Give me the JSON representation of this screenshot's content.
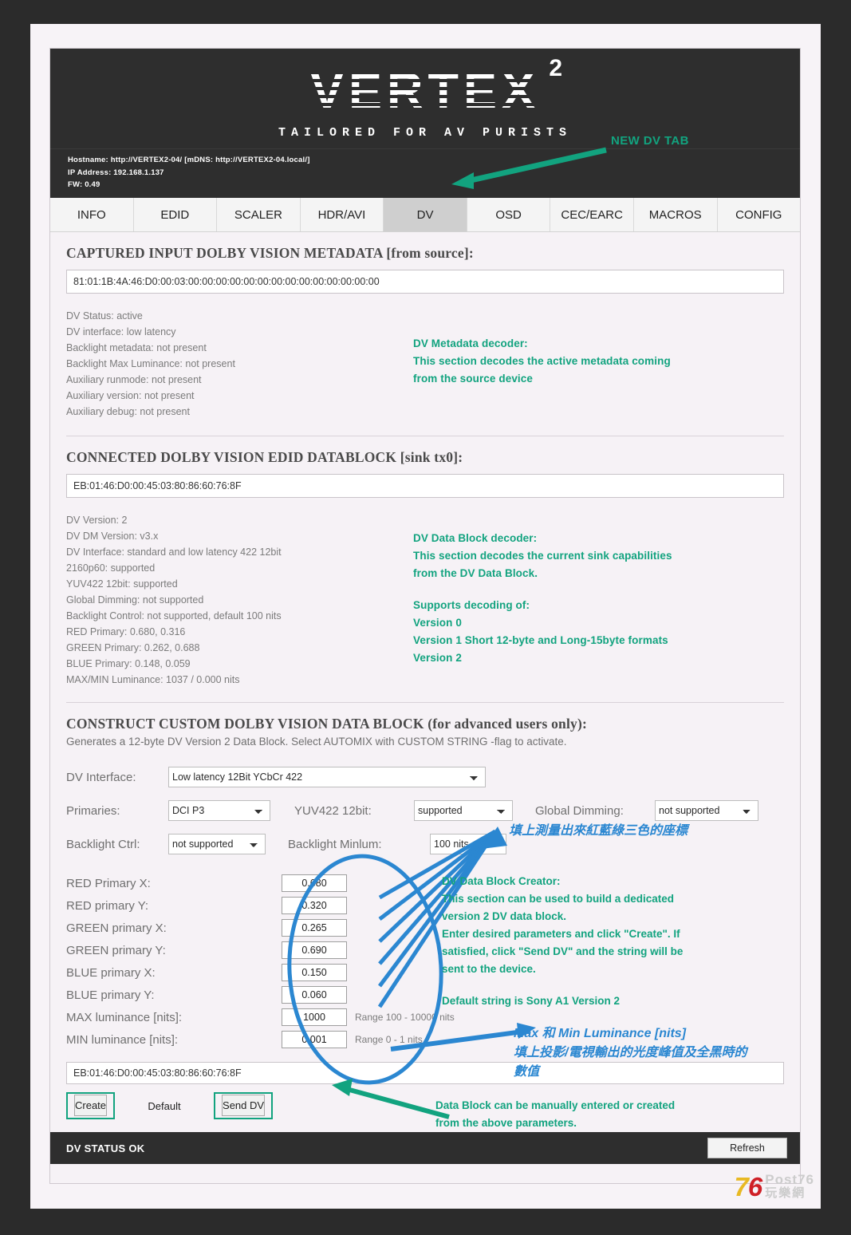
{
  "header": {
    "logo_text": "VERTEX",
    "logo_sup": "2",
    "tagline": "TAILORED FOR AV PURISTS",
    "hostname_line": "Hostname: http://VERTEX2-04/ [mDNS: http://VERTEX2-04.local/]",
    "ip_line": "IP Address: 192.168.1.137",
    "fw_line": "FW: 0.49"
  },
  "tabs": [
    {
      "label": "INFO",
      "active": false
    },
    {
      "label": "EDID",
      "active": false
    },
    {
      "label": "SCALER",
      "active": false
    },
    {
      "label": "HDR/AVI",
      "active": false
    },
    {
      "label": "DV",
      "active": true
    },
    {
      "label": "OSD",
      "active": false
    },
    {
      "label": "CEC/EARC",
      "active": false
    },
    {
      "label": "MACROS",
      "active": false
    },
    {
      "label": "CONFIG",
      "active": false
    }
  ],
  "captured": {
    "heading": "CAPTURED INPUT DOLBY VISION METADATA [from source]:",
    "string": "81:01:1B:4A:46:D0:00:03:00:00:00:00:00:00:00:00:00:00:00:00:00:00",
    "lines": [
      "DV Status: active",
      "DV interface: low latency",
      "Backlight metadata: not present",
      "Backlight Max Luminance: not present",
      "Auxiliary runmode: not present",
      "Auxiliary version: not present",
      "Auxiliary debug: not present"
    ],
    "note": [
      "DV Metadata decoder:",
      "This section decodes the active metadata coming",
      "from the source device"
    ]
  },
  "edid": {
    "heading": "CONNECTED DOLBY VISION EDID DATABLOCK [sink tx0]:",
    "string": "EB:01:46:D0:00:45:03:80:86:60:76:8F",
    "lines": [
      "DV Version: 2",
      "DV DM Version: v3.x",
      "DV Interface: standard and low latency 422 12bit",
      "2160p60: supported",
      "YUV422 12bit: supported",
      "Global Dimming: not supported",
      "Backlight Control: not supported, default 100 nits",
      "RED Primary: 0.680, 0.316",
      "GREEN Primary: 0.262, 0.688",
      "BLUE Primary: 0.148, 0.059",
      "MAX/MIN Luminance: 1037 / 0.000 nits"
    ],
    "note_a": [
      "DV Data Block decoder:",
      "This section decodes the current sink capabilities",
      "from the DV Data Block."
    ],
    "note_b": [
      "Supports decoding of:",
      "Version 0",
      "Version 1 Short 12-byte and Long-15byte formats",
      "Version 2"
    ]
  },
  "construct": {
    "heading": "CONSTRUCT CUSTOM DOLBY VISION DATA BLOCK (for advanced users only):",
    "subheading": "Generates a 12-byte DV Version 2 Data Block. Select AUTOMIX with CUSTOM STRING -flag to activate.",
    "fields": {
      "dv_interface_label": "DV Interface:",
      "dv_interface_value": "Low latency 12Bit YCbCr 422",
      "primaries_label": "Primaries:",
      "primaries_value": "DCI P3",
      "yuv422_label": "YUV422 12bit:",
      "yuv422_value": "supported",
      "global_dimming_label": "Global Dimming:",
      "global_dimming_value": "not supported",
      "backlight_ctrl_label": "Backlight Ctrl:",
      "backlight_ctrl_value": "not supported",
      "backlight_minlum_label": "Backlight Minlum:",
      "backlight_minlum_value": "100 nits"
    },
    "primaries": [
      {
        "label": "RED Primary X:",
        "value": "0.680",
        "range": ""
      },
      {
        "label": "RED primary Y:",
        "value": "0.320",
        "range": ""
      },
      {
        "label": "GREEN primary X:",
        "value": "0.265",
        "range": ""
      },
      {
        "label": "GREEN primary Y:",
        "value": "0.690",
        "range": ""
      },
      {
        "label": "BLUE primary X:",
        "value": "0.150",
        "range": ""
      },
      {
        "label": "BLUE primary Y:",
        "value": "0.060",
        "range": ""
      },
      {
        "label": "MAX luminance [nits]:",
        "value": "1000",
        "range": "Range 100 - 10000 nits"
      },
      {
        "label": "MIN luminance [nits]:",
        "value": "0.001",
        "range": "Range 0 - 1 nits"
      }
    ],
    "result_string": "EB:01:46:D0:00:45:03:80:86:60:76:8F",
    "buttons": {
      "create": "Create",
      "default": "Default",
      "send_dv": "Send DV"
    },
    "note_creator": [
      "DV Data Block Creator:",
      "This section can be used to build a dedicated",
      "version 2 DV data block.",
      "Enter desired parameters and click \"Create\". If",
      "satisfied, click \"Send DV\" and the string will be",
      "sent to the device."
    ],
    "note_default": "Default string is Sony A1 Version 2",
    "note_datablock": [
      "Data Block can be manually entered or created",
      "from the above parameters."
    ]
  },
  "status": {
    "text": "DV STATUS OK",
    "refresh_label": "Refresh"
  },
  "annotations": {
    "new_dv_tab": "NEW DV TAB",
    "blue_primaries": "填上測量出來紅藍綠三色的座標",
    "blue_luminance_1": "Max 和 Min Luminance [nits]",
    "blue_luminance_2": "填上投影/電視輸出的光度峰值及全黑時的",
    "blue_luminance_3": "數值"
  },
  "watermark": {
    "digits_7": "7",
    "digits_6": "6",
    "post76": "Post76",
    "cn": "玩樂網"
  },
  "colors": {
    "accent_green": "#12a37f",
    "accent_blue": "#2b87d1",
    "header_dark": "#2e2e2e",
    "page_bg": "#f6f2f6"
  }
}
